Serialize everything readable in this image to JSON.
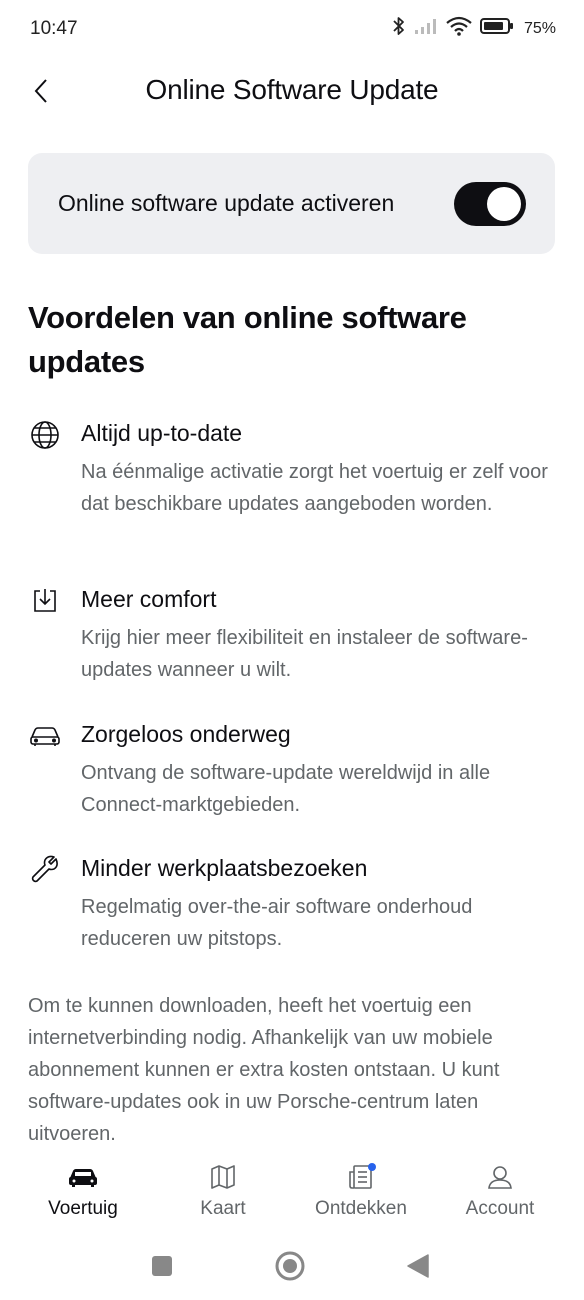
{
  "status_bar": {
    "time": "10:47",
    "battery_percent": "75"
  },
  "header": {
    "title": "Online Software Update"
  },
  "toggle": {
    "label": "Online software update activeren",
    "enabled": true
  },
  "section": {
    "title": "Voordelen van online software updates"
  },
  "benefits": [
    {
      "icon": "globe-icon",
      "title": "Altijd up-to-date",
      "description": "Na éénmalige activatie zorgt het voertuig er zelf voor dat beschikbare updates aangeboden worden."
    },
    {
      "icon": "download-icon",
      "title": "Meer comfort",
      "description": "Krijg hier meer flexibiliteit en instaleer de software-updates wanneer u wilt."
    },
    {
      "icon": "car-icon",
      "title": "Zorgeloos onderweg",
      "description": "Ontvang de software-update wereldwijd in alle Connect-marktgebieden."
    },
    {
      "icon": "wrench-icon",
      "title": "Minder werkplaatsbezoeken",
      "description": "Regelmatig over-the-air software onderhoud reduceren uw pitstops."
    }
  ],
  "footnote": "Om te kunnen downloaden, heeft het voertuig een internetverbinding nodig. Afhankelijk van uw mobiele abonnement kunnen er extra kosten ontstaan. U kunt software-updates ook in uw Porsche-centrum laten uitvoeren.",
  "bottom_nav": {
    "items": [
      {
        "label": "Voertuig",
        "icon": "car-icon",
        "active": true
      },
      {
        "label": "Kaart",
        "icon": "map-icon",
        "active": false
      },
      {
        "label": "Ontdekken",
        "icon": "news-icon",
        "active": false,
        "badge": true
      },
      {
        "label": "Account",
        "icon": "user-icon",
        "active": false
      }
    ]
  },
  "colors": {
    "primary_text": "#0e0e12",
    "secondary_text": "#626669",
    "card_background": "#eeeff2",
    "badge": "#2762ec"
  }
}
